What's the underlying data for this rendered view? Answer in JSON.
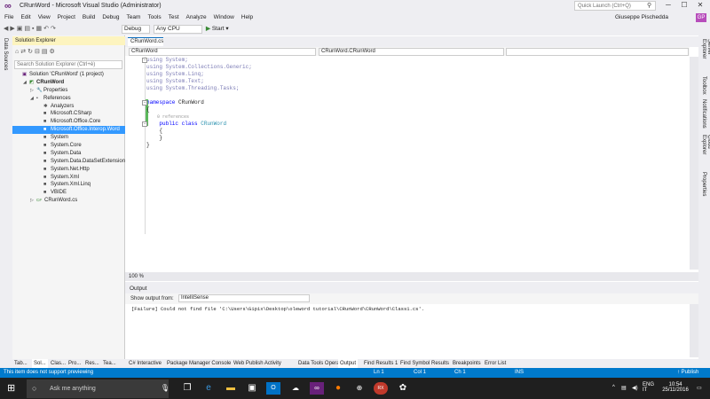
{
  "titlebar": {
    "title": "CRunWord - Microsoft Visual Studio (Administrator)",
    "quick_launch_placeholder": "Quick Launch (Ctrl+Q)",
    "win_buttons": [
      "─",
      "☐",
      "✕"
    ]
  },
  "menubar": {
    "items": [
      "File",
      "Edit",
      "View",
      "Project",
      "Build",
      "Debug",
      "Team",
      "Tools",
      "Test",
      "Analyze",
      "Window",
      "Help"
    ],
    "user": "Giuseppe Pischedda",
    "avatar": "GP"
  },
  "toolbar": {
    "config": "Debug",
    "platform": "Any CPU",
    "start": "Start"
  },
  "left_strip": {
    "label": "Data Sources"
  },
  "solution_explorer": {
    "title": "Solution Explorer",
    "search_placeholder": "Search Solution Explorer (Ctrl+è)",
    "tree": [
      {
        "label": "Solution 'CRunWord' (1 project)",
        "indent": 0,
        "icon": "solution-icon",
        "tri": ""
      },
      {
        "label": "CRunWord",
        "indent": 1,
        "icon": "project-icon",
        "tri": "◢",
        "bold": true
      },
      {
        "label": "Properties",
        "indent": 2,
        "icon": "wrench-icon",
        "tri": "▷"
      },
      {
        "label": "References",
        "indent": 2,
        "icon": "references-icon",
        "tri": "◢"
      },
      {
        "label": "Analyzers",
        "indent": 3,
        "icon": "analyzer-icon",
        "tri": ""
      },
      {
        "label": "Microsoft.CSharp",
        "indent": 3,
        "icon": "assembly-icon",
        "tri": ""
      },
      {
        "label": "Microsoft.Office.Core",
        "indent": 3,
        "icon": "assembly-icon",
        "tri": ""
      },
      {
        "label": "Microsoft.Office.Interop.Word",
        "indent": 3,
        "icon": "assembly-icon",
        "tri": "",
        "selected": true
      },
      {
        "label": "System",
        "indent": 3,
        "icon": "assembly-icon",
        "tri": ""
      },
      {
        "label": "System.Core",
        "indent": 3,
        "icon": "assembly-icon",
        "tri": ""
      },
      {
        "label": "System.Data",
        "indent": 3,
        "icon": "assembly-icon",
        "tri": ""
      },
      {
        "label": "System.Data.DataSetExtensions",
        "indent": 3,
        "icon": "assembly-icon",
        "tri": ""
      },
      {
        "label": "System.Net.Http",
        "indent": 3,
        "icon": "assembly-icon",
        "tri": ""
      },
      {
        "label": "System.Xml",
        "indent": 3,
        "icon": "assembly-icon",
        "tri": ""
      },
      {
        "label": "System.Xml.Linq",
        "indent": 3,
        "icon": "assembly-icon",
        "tri": ""
      },
      {
        "label": "VBIDE",
        "indent": 3,
        "icon": "assembly-icon",
        "tri": ""
      },
      {
        "label": "CRunWord.cs",
        "indent": 2,
        "icon": "csharp-file-icon",
        "tri": "▷"
      }
    ]
  },
  "editor": {
    "tab": "CRunWord.cs",
    "nav_left": "CRunWord",
    "nav_mid": "CRunWord.CRunWord",
    "nav_right": "",
    "zoom": "100 %",
    "lines": [
      {
        "parts": [
          {
            "t": "using",
            "c": "usingk"
          },
          {
            "t": " System;",
            "c": "usingk"
          }
        ],
        "fold": "−"
      },
      {
        "parts": [
          {
            "t": "using",
            "c": "usingk"
          },
          {
            "t": " System.Collections.Generic;",
            "c": "usingk"
          }
        ]
      },
      {
        "parts": [
          {
            "t": "using",
            "c": "usingk"
          },
          {
            "t": " System.Linq;",
            "c": "usingk"
          }
        ]
      },
      {
        "parts": [
          {
            "t": "using",
            "c": "usingk"
          },
          {
            "t": " System.Text;",
            "c": "usingk"
          }
        ]
      },
      {
        "parts": [
          {
            "t": "using",
            "c": "usingk"
          },
          {
            "t": " System.Threading.Tasks;",
            "c": "usingk"
          }
        ]
      },
      {
        "parts": [
          {
            "t": "",
            "c": ""
          }
        ]
      },
      {
        "parts": [
          {
            "t": "namespace",
            "c": "kw"
          },
          {
            "t": " CRunWord",
            "c": ""
          }
        ],
        "fold": "−"
      },
      {
        "parts": [
          {
            "t": "{",
            "c": ""
          }
        ]
      },
      {
        "parts": [
          {
            "t": "    0 references",
            "c": "gray"
          }
        ]
      },
      {
        "parts": [
          {
            "t": "    public",
            "c": "kw"
          },
          {
            "t": " ",
            "c": ""
          },
          {
            "t": "class",
            "c": "kw"
          },
          {
            "t": " ",
            "c": ""
          },
          {
            "t": "CRunWord",
            "c": "ty"
          }
        ],
        "fold": "−"
      },
      {
        "parts": [
          {
            "t": "    {",
            "c": ""
          }
        ]
      },
      {
        "parts": [
          {
            "t": "    }",
            "c": ""
          }
        ]
      },
      {
        "parts": [
          {
            "t": "}",
            "c": ""
          }
        ]
      }
    ]
  },
  "output": {
    "title": "Output",
    "show_from_label": "Show output from:",
    "source": "IntelliSense",
    "text": "[Failure] Could not find file 'C:\\Users\\Gipix\\Desktop\\oleword tutorial\\CRunWord\\CRunWord\\Class1.cs'."
  },
  "right_strip": {
    "labels": [
      "Server Explorer",
      "Toolbox",
      "Notifications",
      "Cloud Explorer",
      "Properties"
    ]
  },
  "left_bottom_tabs": [
    "Tab...",
    "Sol...",
    "Clas...",
    "Pro...",
    "Res...",
    "Tea..."
  ],
  "bottom_tabs": [
    "C# Interactive",
    "Package Manager Console",
    "Web Publish Activity",
    "Data Tools Operations",
    "Output",
    "Find Results 1",
    "Find Symbol Results",
    "Breakpoints",
    "Error List"
  ],
  "statusbar": {
    "message": "This item does not support previewing",
    "ln": "Ln 1",
    "col": "Col 1",
    "ch": "Ch 1",
    "ins": "INS",
    "publish": "↑ Publish"
  },
  "taskbar": {
    "search": "Ask me anything",
    "lang": "ENG",
    "region": "IT",
    "time": "10:54",
    "date": "25/11/2016"
  },
  "colors": {
    "accent": "#007acc",
    "selected": "#3399ff",
    "vs_purple": "#68217a",
    "taskbar": "#1f1f1f"
  }
}
